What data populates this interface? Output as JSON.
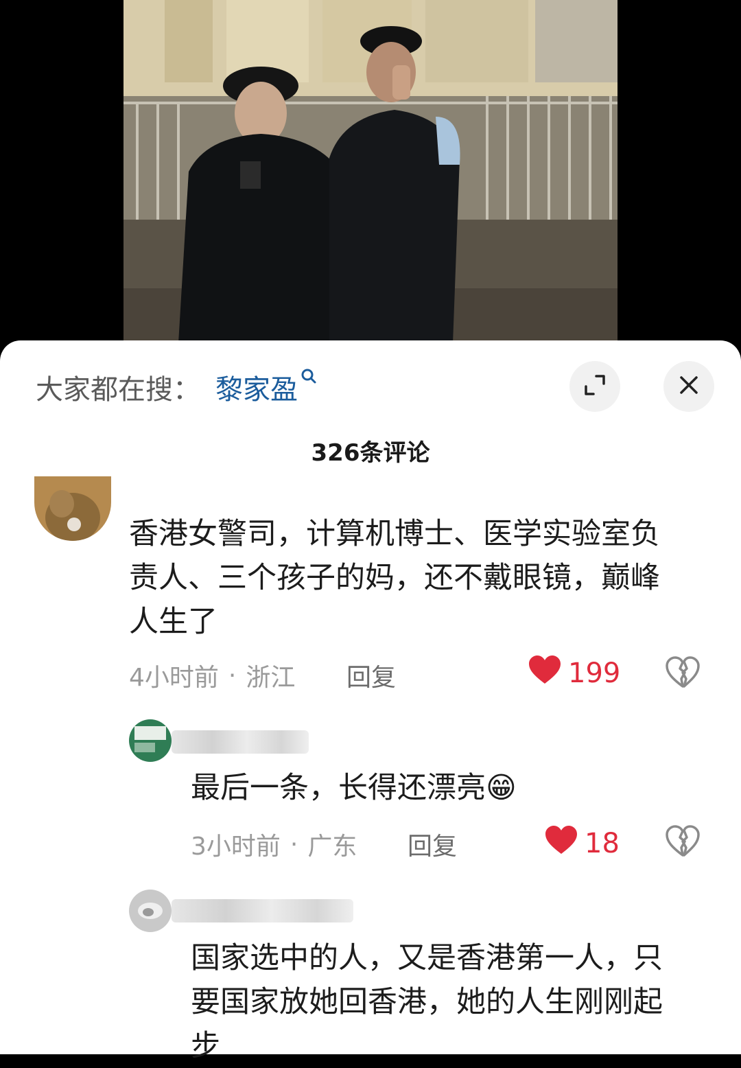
{
  "search": {
    "prefix": "大家都在搜：",
    "term": "黎家盈",
    "mini_icon": "search-icon"
  },
  "buttons": {
    "expand_icon": "expand-icon",
    "close_icon": "close-icon"
  },
  "comments_count_label": "326条评论",
  "comments": [
    {
      "text_lines": [
        "香港女警司，计算机博士、医学实验室负",
        "责人、三个孩子的妈，还不戴眼镜，巅峰",
        "人生了"
      ],
      "time": "4小时前",
      "dot": "·",
      "location": "浙江",
      "reply_label": "回复",
      "likes": "199"
    }
  ],
  "replies": [
    {
      "text": "最后一条，长得还漂亮😁",
      "time": "3小时前",
      "dot": "·",
      "location": "广东",
      "reply_label": "回复",
      "likes": "18"
    },
    {
      "text_lines": [
        "国家选中的人，又是香港第一人，只",
        "要国家放她回香港，她的人生刚刚起",
        "步"
      ]
    }
  ],
  "colors": {
    "like_red": "#e02b3c",
    "link_blue": "#1b5c9c",
    "meta_gray": "#9a9a9a"
  }
}
